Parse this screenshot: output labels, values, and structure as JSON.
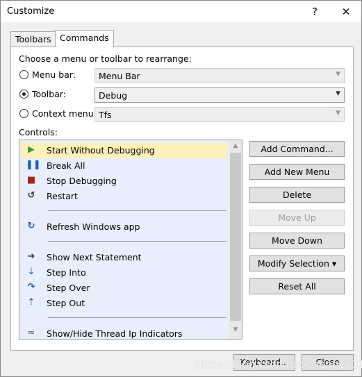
{
  "window": {
    "title": "Customize",
    "help": "?",
    "close": "✕"
  },
  "tabs": [
    {
      "label": "Toolbars"
    },
    {
      "label": "Commands"
    }
  ],
  "prompt": "Choose a menu or toolbar to rearrange:",
  "options": [
    {
      "label": "Menu bar:",
      "value": "Menu Bar",
      "selected": false,
      "enabled": false
    },
    {
      "label": "Toolbar:",
      "value": "Debug",
      "selected": true,
      "enabled": true
    },
    {
      "label": "Context menu:",
      "value": "Tfs",
      "selected": false,
      "enabled": false
    }
  ],
  "controls_label": "Controls:",
  "controls": [
    {
      "label": "Start Without Debugging",
      "icon": "play-icon",
      "selected": true
    },
    {
      "label": "Break All",
      "icon": "pause-icon"
    },
    {
      "label": "Stop Debugging",
      "icon": "stop-icon"
    },
    {
      "label": "Restart",
      "icon": "restart-icon"
    },
    {
      "label": "Refresh Windows app",
      "icon": "refresh-icon",
      "separator_before": true
    },
    {
      "label": "Show Next Statement",
      "icon": "arrow-right-icon",
      "separator_before": true
    },
    {
      "label": "Step Into",
      "icon": "step-into-icon"
    },
    {
      "label": "Step Over",
      "icon": "step-over-icon"
    },
    {
      "label": "Step Out",
      "icon": "step-out-icon"
    },
    {
      "label": "Show/Hide Thread Ip Indicators",
      "icon": "thread-indicator-icon",
      "separator_before": true
    }
  ],
  "buttons": {
    "add_command": "Add Command...",
    "add_menu": "Add New Menu",
    "delete": "Delete",
    "move_up": "Move Up",
    "move_down": "Move Down",
    "modify": "Modify Selection ▾",
    "reset": "Reset All"
  },
  "footer": {
    "keyboard": "Keyboard...",
    "close": "Close"
  },
  "watermark": "https://blog.csdn.net/chengyq116"
}
